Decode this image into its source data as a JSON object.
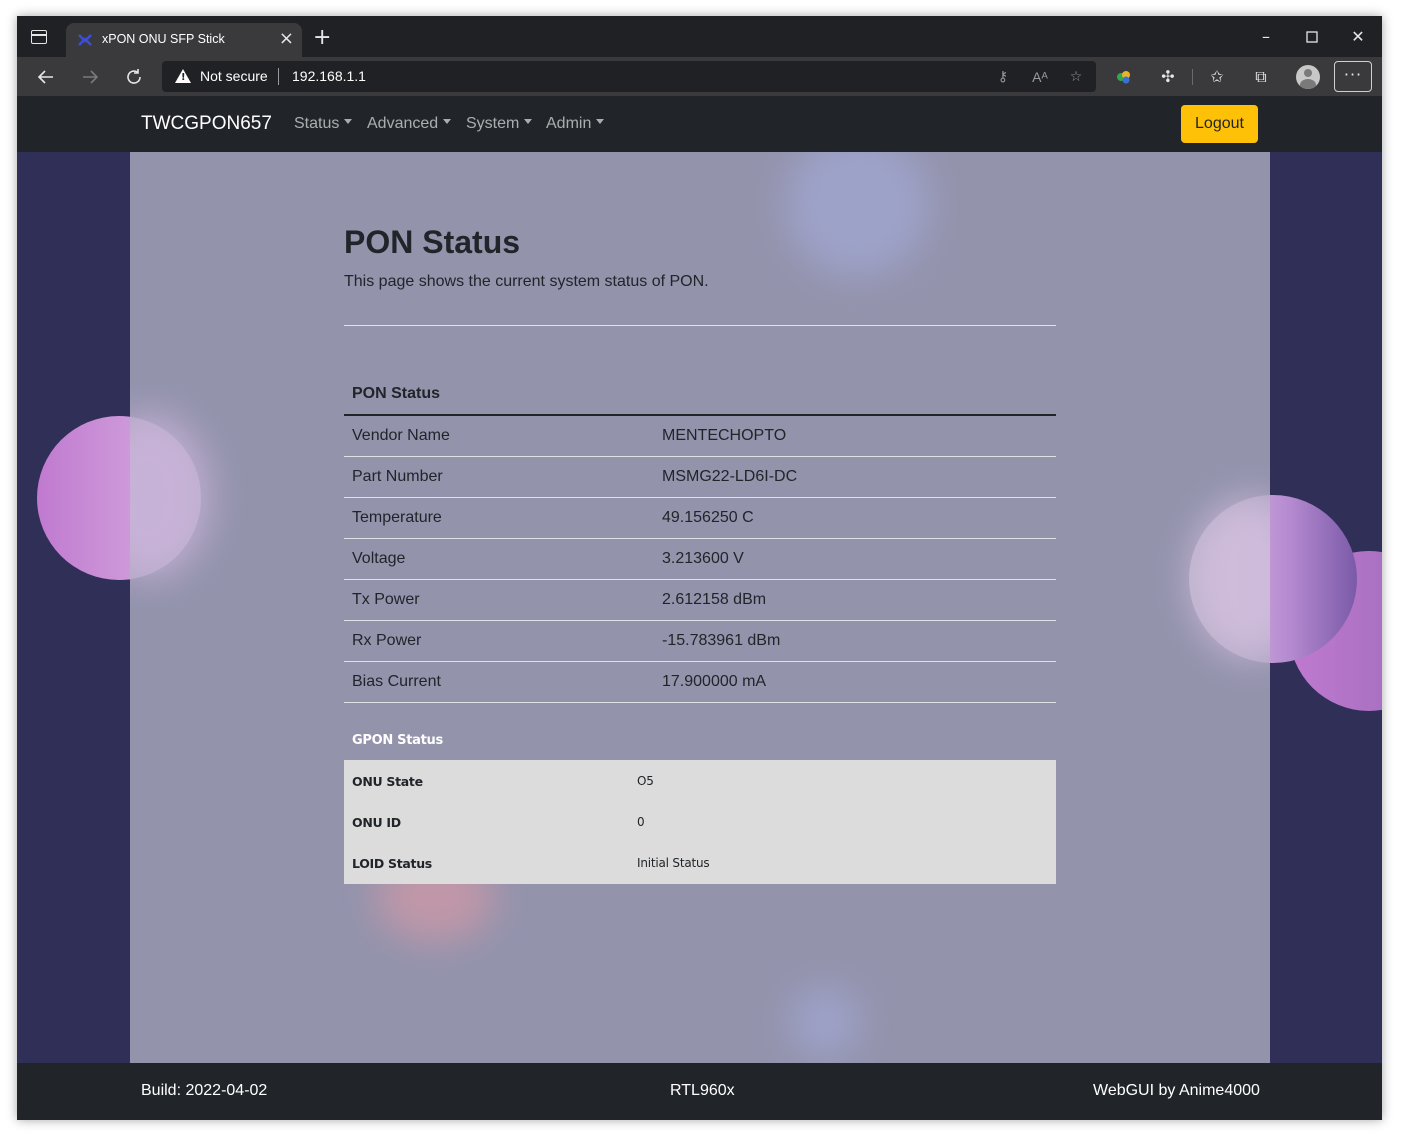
{
  "browser": {
    "tab_title": "xPON ONU SFP Stick",
    "security_label": "Not secure",
    "url": "192.168.1.1"
  },
  "navbar": {
    "brand": "TWCGPON657",
    "menus": [
      "Status",
      "Advanced",
      "System",
      "Admin"
    ],
    "logout_label": "Logout",
    "accent_color": "#ffc107"
  },
  "header": {
    "title": "PON Status",
    "description": "This page shows the current system status of PON."
  },
  "pon_table": {
    "heading": "PON Status",
    "rows": [
      {
        "label": "Vendor Name",
        "value": "MENTECHOPTO"
      },
      {
        "label": "Part Number",
        "value": "MSMG22-LD6I-DC"
      },
      {
        "label": "Temperature",
        "value": "49.156250 C"
      },
      {
        "label": "Voltage",
        "value": "3.213600 V"
      },
      {
        "label": "Tx Power",
        "value": "2.612158 dBm"
      },
      {
        "label": "Rx Power",
        "value": "-15.783961 dBm"
      },
      {
        "label": "Bias Current",
        "value": "17.900000 mA"
      }
    ]
  },
  "gpon_table": {
    "heading": "GPON Status",
    "rows": [
      {
        "label": "ONU State",
        "value": "O5"
      },
      {
        "label": "ONU ID",
        "value": "0"
      },
      {
        "label": "LOID Status",
        "value": "Initial Status"
      }
    ]
  },
  "footer": {
    "build": "Build: 2022-04-02",
    "chip": "RTL960x",
    "credit": "WebGUI by Anime4000"
  }
}
